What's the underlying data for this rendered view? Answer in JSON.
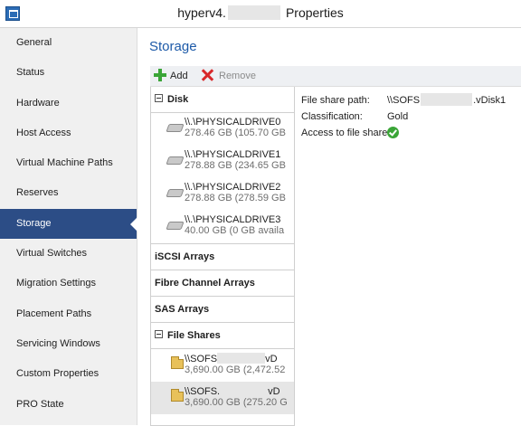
{
  "window": {
    "title_prefix": "hyperv4.",
    "title_suffix": "Properties"
  },
  "nav": {
    "items": [
      {
        "label": "General"
      },
      {
        "label": "Status"
      },
      {
        "label": "Hardware"
      },
      {
        "label": "Host Access"
      },
      {
        "label": "Virtual Machine Paths"
      },
      {
        "label": "Reserves"
      },
      {
        "label": "Storage",
        "selected": true
      },
      {
        "label": "Virtual Switches"
      },
      {
        "label": "Migration Settings"
      },
      {
        "label": "Placement Paths"
      },
      {
        "label": "Servicing Windows"
      },
      {
        "label": "Custom Properties"
      },
      {
        "label": "PRO State"
      }
    ]
  },
  "main": {
    "title": "Storage",
    "toolbar": {
      "add_label": "Add",
      "remove_label": "Remove"
    }
  },
  "tree": {
    "disk": {
      "header": "Disk",
      "drives": [
        {
          "name": "\\\\.\\PHYSICALDRIVE0",
          "size": "278.46 GB (105.70 GB"
        },
        {
          "name": "\\\\.\\PHYSICALDRIVE1",
          "size": "278.88 GB (234.65 GB"
        },
        {
          "name": "\\\\.\\PHYSICALDRIVE2",
          "size": "278.88 GB (278.59 GB"
        },
        {
          "name": "\\\\.\\PHYSICALDRIVE3",
          "size": "40.00 GB (0 GB availa"
        }
      ]
    },
    "iscsi_header": "iSCSI Arrays",
    "fibre_header": "Fibre Channel Arrays",
    "sas_header": "SAS Arrays",
    "shares": {
      "header": "File Shares",
      "items": [
        {
          "name_prefix": "\\\\SOFS",
          "name_suffix": "vD",
          "size": "3,690.00 GB (2,472.52"
        },
        {
          "name_prefix": "\\\\SOFS.",
          "name_suffix": "vD",
          "size": "3,690.00 GB (275.20 G",
          "selected": true
        }
      ]
    }
  },
  "details": {
    "path_label": "File share path:",
    "path_prefix": "\\\\SOFS",
    "path_suffix": ".vDisk1",
    "class_label": "Classification:",
    "class_value": "Gold",
    "access_label": "Access to file share:",
    "access_icon": "check-icon",
    "access_color": "#3aa537"
  },
  "colors": {
    "nav_selected": "#2c4d86",
    "title_accent": "#1d5aa8"
  }
}
